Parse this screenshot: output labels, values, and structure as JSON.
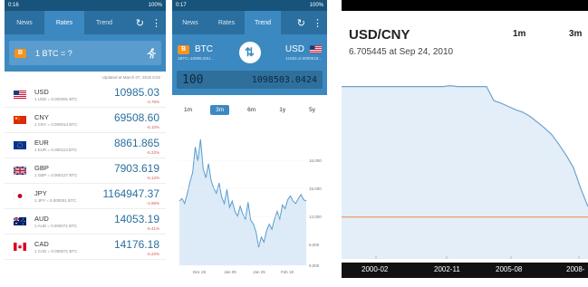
{
  "screen1": {
    "status": {
      "time": "0:16",
      "battery": "100%"
    },
    "tabs": [
      {
        "label": "News"
      },
      {
        "label": "Rates"
      },
      {
        "label": "Trend"
      }
    ],
    "converter": {
      "badge": "B",
      "equation": "1 BTC = ?"
    },
    "updated": "Updated at March 07, 2015 5:02",
    "rates": [
      {
        "code": "USD",
        "sub": "1 USD = 0.000091 BTC",
        "value": "10985.03",
        "change": "-4.76%"
      },
      {
        "code": "CNY",
        "sub": "1 CNY = 0.000014 BTC",
        "value": "69508.60",
        "change": "-5.10%"
      },
      {
        "code": "EUR",
        "sub": "1 EUR = 0.000113 BTC",
        "value": "8861.865",
        "change": "-5.22%"
      },
      {
        "code": "GBP",
        "sub": "1 GBP = 0.000127 BTC",
        "value": "7903.619",
        "change": "-5.12%"
      },
      {
        "code": "JPY",
        "sub": "1 JPY = 0.000001 BTC",
        "value": "1164947.37",
        "change": "-4.96%"
      },
      {
        "code": "AUD",
        "sub": "1 AUD = 0.000071 BTC",
        "value": "14053.19",
        "change": "-5.41%"
      },
      {
        "code": "CAD",
        "sub": "1 CAD = 0.000071 BTC",
        "value": "14176.18",
        "change": "-5.22%"
      }
    ]
  },
  "screen2": {
    "status": {
      "time": "0:17",
      "battery": "100%"
    },
    "tabs": [
      {
        "label": "News"
      },
      {
        "label": "Rates"
      },
      {
        "label": "Trend"
      }
    ],
    "pair": {
      "from": "BTC",
      "to": "USD",
      "from_sub": "1BTC=10985.03U...",
      "to_sub": "1USD=0.0000018..."
    },
    "lcd": {
      "amount": "100",
      "result": "1098503.0424"
    },
    "ranges": [
      "1m",
      "3m",
      "6m",
      "1y",
      "5y"
    ],
    "active_range": "3m",
    "chart_data": {
      "type": "line",
      "x_ticks": [
        "Dec 25",
        "Jan 09",
        "Jan 25",
        "Feb 18"
      ],
      "y_ticks": [
        "16,000",
        "15,000",
        "12,000",
        "9,000",
        "6,000"
      ],
      "ylim": [
        6000,
        16000
      ],
      "values": [
        11000,
        11200,
        10800,
        11600,
        12500,
        13200,
        15200,
        14100,
        15800,
        13500,
        12800,
        13900,
        12600,
        12000,
        11600,
        12400,
        11300,
        10800,
        11900,
        10500,
        11000,
        10200,
        9800,
        10600,
        10000,
        9600,
        10900,
        9500,
        9200,
        8600,
        7400,
        8200,
        7800,
        8700,
        9200,
        8800,
        9600,
        10200,
        9600,
        10700,
        10400,
        11100,
        11400,
        11000,
        10800,
        11200,
        11500,
        11100,
        11000
      ]
    }
  },
  "screen3": {
    "title": "USD/CNY",
    "subtitle": "6.705445 at Sep 24, 2010",
    "ranges": [
      "1m",
      "3m"
    ],
    "chart_data": {
      "type": "line",
      "x_ticks": [
        "2000-02",
        "2002-11",
        "2005-08",
        "2008-"
      ],
      "reference_line": 6.705445,
      "values": [
        8.28,
        8.28,
        8.28,
        8.28,
        8.28,
        8.28,
        8.28,
        8.28,
        8.28,
        8.28,
        8.28,
        8.28,
        8.28,
        8.28,
        8.28,
        8.29,
        8.28,
        8.28,
        8.28,
        8.28,
        8.28,
        8.11,
        8.08,
        8.04,
        8.0,
        7.97,
        7.92,
        7.85,
        7.78,
        7.7,
        7.58,
        7.45,
        7.3,
        7.05,
        6.83
      ]
    }
  }
}
